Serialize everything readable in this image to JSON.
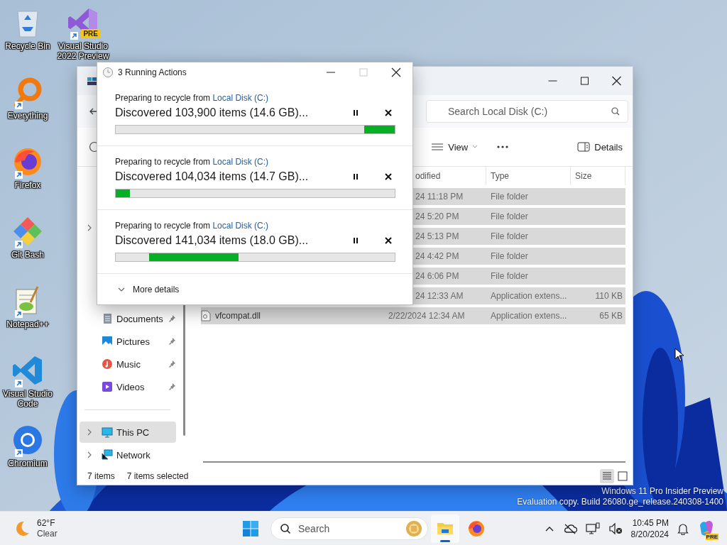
{
  "desktop": {
    "icon_columns": [
      [
        {
          "label": "Recycle Bin",
          "shortcut": false
        },
        {
          "label": "Everything",
          "shortcut": true
        },
        {
          "label": "Firefox",
          "shortcut": true
        },
        {
          "label": "Git Bash",
          "shortcut": true
        },
        {
          "label": "Notepad++",
          "shortcut": true
        },
        {
          "label": "Visual Studio Code",
          "shortcut": true
        },
        {
          "label": "Chromium",
          "shortcut": true
        }
      ],
      [
        {
          "label": "Visual Studio 2022 Preview",
          "shortcut": true,
          "badge": "PRE"
        }
      ]
    ],
    "watermark": [
      "Windows 11 Pro Insider Preview",
      "Evaluation copy. Build 26080.ge_release.240308-1400"
    ]
  },
  "explorer": {
    "search": {
      "placeholder": "Search Local Disk (C:)"
    },
    "toolbar": {
      "view": "View",
      "details": "Details"
    },
    "sidebar": {
      "groups": [
        [
          {
            "expandable": true,
            "selected": false
          },
          {
            "label": "Documents",
            "pinned": true,
            "selected": false
          },
          {
            "label": "Pictures",
            "pinned": true,
            "selected": false
          },
          {
            "label": "Music",
            "pinned": true,
            "selected": false
          },
          {
            "label": "Videos",
            "pinned": true,
            "selected": false
          }
        ],
        [
          {
            "label": "This PC",
            "expandable": true,
            "selected": true
          },
          {
            "label": "Network",
            "expandable": true,
            "selected": false
          }
        ]
      ]
    },
    "columns": [
      "odified",
      "Type",
      "Size"
    ],
    "rows": [
      {
        "modified": "24 11:18 PM",
        "type": "File folder",
        "selected": true
      },
      {
        "modified": "24 5:20 PM",
        "type": "File folder",
        "selected": true
      },
      {
        "modified": "24 5:13 PM",
        "type": "File folder",
        "selected": true
      },
      {
        "modified": "24 4:42 PM",
        "type": "File folder",
        "selected": true
      },
      {
        "modified": "24 6:06 PM",
        "type": "File folder",
        "selected": true
      },
      {
        "modified": "24 12:33 AM",
        "type": "Application extens...",
        "size": "110 KB",
        "selected": true
      },
      {
        "name": "vfcompat.dll",
        "modified": "2/22/2024 12:34 AM",
        "type": "Application extens...",
        "size": "65 KB",
        "selected": true
      }
    ],
    "status": {
      "count": "7 items",
      "selection": "7 items selected"
    },
    "view_buttons": [
      {
        "selected": true
      },
      {
        "selected": false
      }
    ]
  },
  "dialog": {
    "title": "3 Running Actions",
    "maximize_disabled": true,
    "operations": [
      {
        "source_prefix": "Preparing to recycle from",
        "source_link": "Local Disk (C:)",
        "status": "Discovered 103,900 items (14.6 GB)...",
        "level": 0.11,
        "kind": "end"
      },
      {
        "source_prefix": "Preparing to recycle from",
        "source_link": "Local Disk (C:)",
        "status": "Discovered 104,034 items (14.7 GB)...",
        "level": 0.05,
        "kind": "start"
      },
      {
        "source_prefix": "Preparing to recycle from",
        "source_link": "Local Disk (C:)",
        "status": "Discovered 141,034 items (18.0 GB)...",
        "level": 0.32,
        "kind": "middle"
      }
    ],
    "more": "More details"
  },
  "taskbar": {
    "weather": {
      "temp": "62°F",
      "condition": "Clear"
    },
    "search": {
      "placeholder": "Search"
    },
    "apps": [
      {
        "active": true
      },
      {
        "active": false
      }
    ],
    "clock": {
      "time": "10:45 PM",
      "date": "8/20/2024"
    },
    "copilot_badge": "PRE"
  }
}
